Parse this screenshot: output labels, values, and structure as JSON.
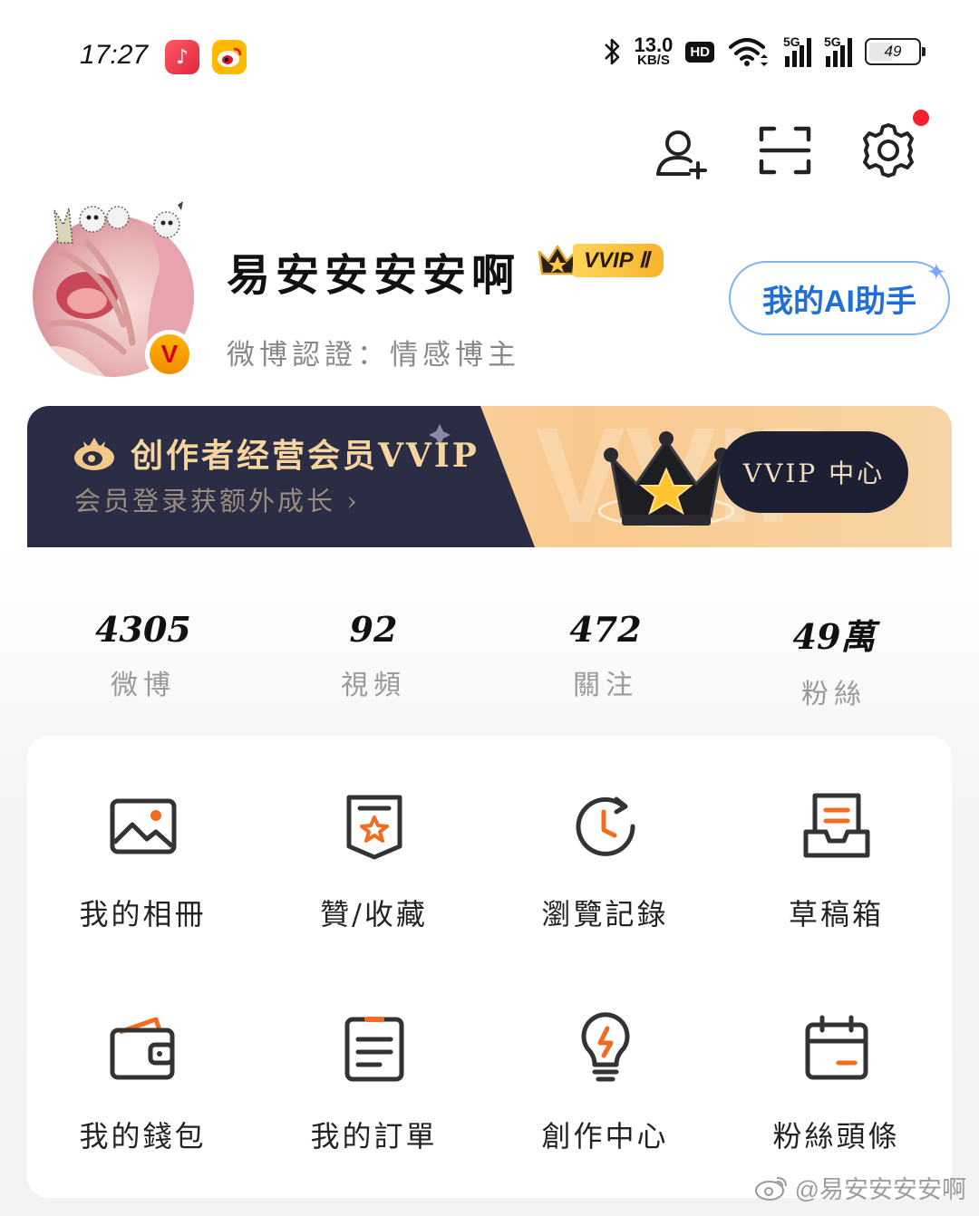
{
  "status_bar": {
    "time": "17:27",
    "net_speed_value": "13.0",
    "net_speed_unit": "KB/S",
    "hd_label": "HD",
    "signal1_label": "5G",
    "signal2_label": "5G",
    "battery_level": "49"
  },
  "profile": {
    "username": "易安安安安啊",
    "vip_badge": "VVIP Ⅱ",
    "verification": "微博認證：情感博主",
    "ai_button": "我的AI助手"
  },
  "banner": {
    "title": "创作者经营会员VVIP",
    "subtitle": "会员登录获额外成长",
    "button": "VVIP 中心",
    "watermark": "VVIP"
  },
  "stats": [
    {
      "value": "4305",
      "label": "微博"
    },
    {
      "value": "92",
      "label": "視頻"
    },
    {
      "value": "472",
      "label": "關注"
    },
    {
      "value": "49萬",
      "label": "粉絲"
    }
  ],
  "grid": [
    {
      "label": "我的相冊",
      "icon": "photo-album-icon"
    },
    {
      "label": "贊/收藏",
      "icon": "bookmark-star-icon"
    },
    {
      "label": "瀏覽記錄",
      "icon": "history-clock-icon"
    },
    {
      "label": "草稿箱",
      "icon": "draft-box-icon"
    },
    {
      "label": "我的錢包",
      "icon": "wallet-icon"
    },
    {
      "label": "我的訂單",
      "icon": "order-list-icon"
    },
    {
      "label": "創作中心",
      "icon": "lightbulb-icon"
    },
    {
      "label": "粉絲頭條",
      "icon": "calendar-icon"
    }
  ],
  "watermark": "@易安安安安啊",
  "colors": {
    "accent_orange": "#f36b21",
    "icon_dark": "#333333",
    "banner_dark": "#2b2d45",
    "banner_gold": "#f6d69e",
    "ai_blue": "#1f6fd6",
    "notification_red": "#f5222d"
  }
}
